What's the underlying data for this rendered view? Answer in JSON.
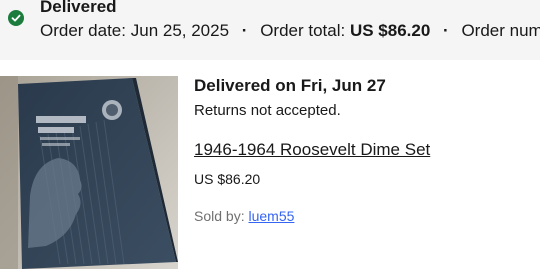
{
  "order": {
    "status": "Delivered",
    "date_label": "Order date:",
    "date_value": "Jun 25, 2025",
    "separator": "·",
    "total_label": "Order total:",
    "total_value": "US $86.20",
    "number_label": "Order number"
  },
  "item": {
    "image_icon": "coin-folder-photo",
    "delivery": "Delivered on Fri, Jun 27",
    "returns": "Returns not accepted.",
    "title": "1946-1964 Roosevelt Dime Set",
    "price": "US $86.20",
    "seller_label": "Sold by:",
    "seller_name": "luem55"
  },
  "colors": {
    "status_green": "#1b7c3d",
    "header_bg": "#f5f5f5",
    "link_blue": "#3665f3",
    "muted_text": "#707070"
  }
}
